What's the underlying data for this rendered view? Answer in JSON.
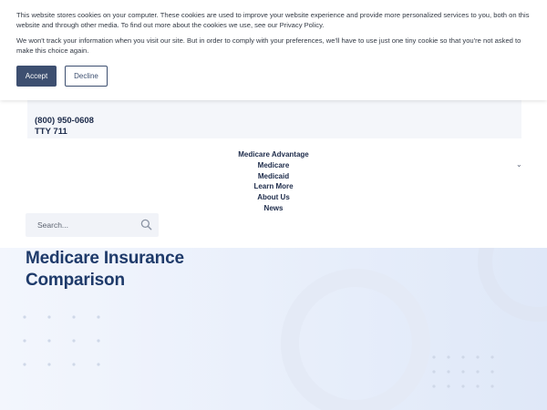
{
  "cookie_banner": {
    "text_1": "This website stores cookies on your computer. These cookies are used to improve your website experience and provide more personalized services to you, both on this website and through other media. To find out more about the cookies we use, see our Privacy Policy.",
    "text_2": "We won't track your information when you visit our site. But in order to comply with your preferences, we'll have to use just one tiny cookie so that you're not asked to make this choice again.",
    "accept_label": "Accept",
    "decline_label": "Decline"
  },
  "header": {
    "phone": "(800) 950-0608",
    "tty": "TTY 711"
  },
  "nav": {
    "items": [
      "Medicare Advantage",
      "Medicare",
      "Medicaid",
      "Learn More",
      "About Us",
      "News"
    ]
  },
  "search": {
    "placeholder": "Search..."
  },
  "hero": {
    "title_line_1": "Medicare Insurance",
    "title_line_2": "Comparison"
  },
  "colors": {
    "accent": "#3d4f70",
    "heading": "#1e3a6a",
    "nav_text": "#1d2b4a"
  },
  "icons": {
    "search": "search-icon",
    "chevron": "chevron-down-icon"
  }
}
